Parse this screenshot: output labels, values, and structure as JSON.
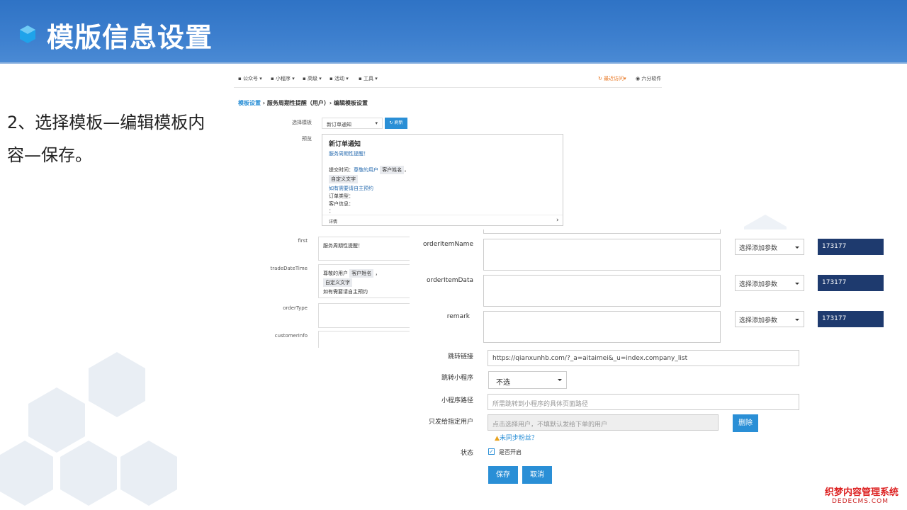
{
  "slide": {
    "title": "模版信息设置",
    "body": [
      "2、选择模板—编辑模板内",
      "容—保存。"
    ]
  },
  "shot1": {
    "nav": [
      "公众号",
      "小程序",
      "高级",
      "活动",
      "工具",
      "最近访问",
      "六分软件"
    ],
    "breadcrumb": {
      "link": "模板设置",
      "rest": "› 服务周期性提醒（用户）› 编辑模板设置"
    },
    "select_template_label": "选择模板",
    "select_template_value": "新订单通知",
    "refresh_label": "刷新",
    "preview_label": "预览",
    "preview": {
      "title": "新订单通知",
      "subtitle": "服务周期性提醒！",
      "line1_prefix": "提交时间：",
      "line1_blue": "尊敬的用户",
      "line1_chip": "客户姓名",
      "line1_suffix": "，",
      "chip2": "自定义文字",
      "line3": "如有需要请自主预约",
      "line4": "订单类型：",
      "line5": "客户信息：",
      "line6": "：",
      "detail": "详情",
      "arrow": "›"
    },
    "fields": [
      {
        "label": "first",
        "lines": [
          "服务周期性提醒！"
        ]
      },
      {
        "label": "tradeDateTime",
        "line1": "尊敬的用户",
        "chip1": "客户姓名",
        "sep": "，",
        "chip2": "自定义文字",
        "line3": "如有需要请自主预约"
      },
      {
        "label": "orderType"
      },
      {
        "label": "customerInfo"
      }
    ]
  },
  "shot2": {
    "rows": [
      {
        "label": "orderItemName",
        "select": "选择添加参数",
        "badge": "173177"
      },
      {
        "label": "orderItemData",
        "select": "选择添加参数",
        "badge": "173177"
      },
      {
        "label": "remark",
        "select": "选择添加参数",
        "badge": "173177"
      }
    ],
    "jump_link_label": "跳转链接",
    "jump_link_value": "https://qianxunhb.com/?_a=aitaimei&_u=index.company_list",
    "jump_mini_label": "跳转小程序",
    "jump_mini_value": "不选",
    "mini_path_label": "小程序路径",
    "mini_path_placeholder": "所需跳转到小程序的具体页面路径",
    "only_user_label": "只发给指定用户",
    "only_user_placeholder": "点击选择用户，不填默认发给下单的用户",
    "delete_label": "删除",
    "sync_warning": "未同步粉丝？",
    "status_label": "状态",
    "status_option": "是否开启",
    "save_label": "保存",
    "cancel_label": "取消"
  },
  "watermark": {
    "line1": "织梦内容管理系统",
    "line2": "DEDECMS.COM"
  },
  "colors": {
    "header": "#3d7fce",
    "primary": "#2a8fd6",
    "badge": "#1e3a6e"
  }
}
